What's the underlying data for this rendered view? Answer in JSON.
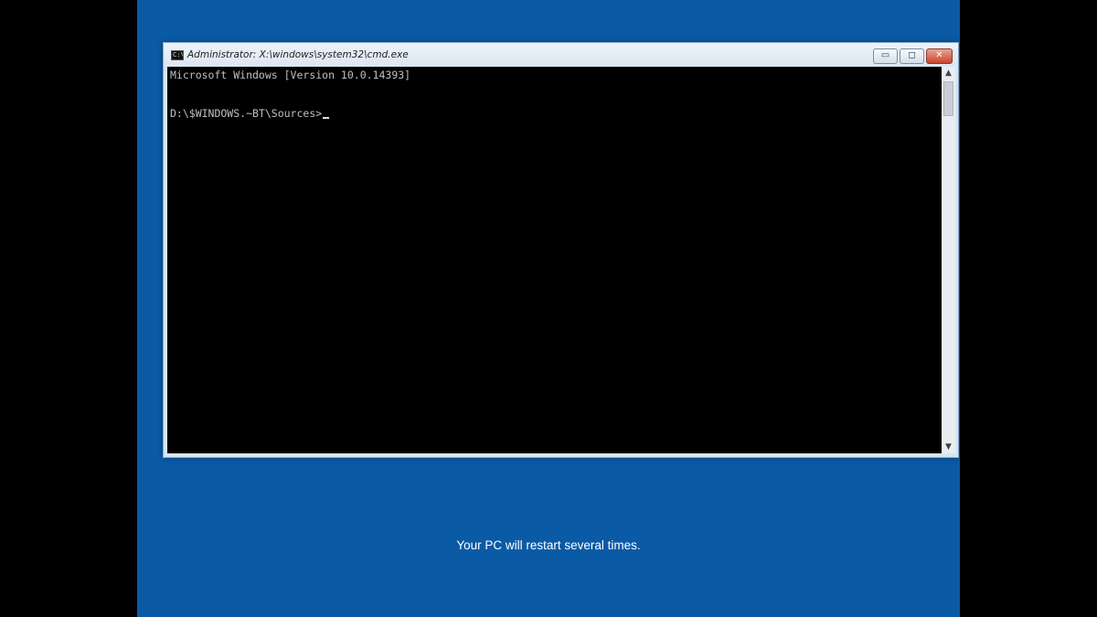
{
  "window": {
    "title": "Administrator: X:\\windows\\system32\\cmd.exe",
    "icon": "cmd-icon",
    "icon_text": "C:\\",
    "minimize_label": "▭",
    "maximize_label": "◻",
    "close_label": "✕"
  },
  "console": {
    "line1": "Microsoft Windows [Version 10.0.14393]",
    "prompt": "D:\\$WINDOWS.~BT\\Sources>"
  },
  "scrollbar": {
    "up_arrow": "▲",
    "down_arrow": "▼"
  },
  "setup": {
    "message": "Your PC will restart several times."
  },
  "colors": {
    "background_blue": "#0a5aa6",
    "console_bg": "#000000",
    "console_text": "#c0c0c0",
    "close_button": "#c8442d"
  }
}
